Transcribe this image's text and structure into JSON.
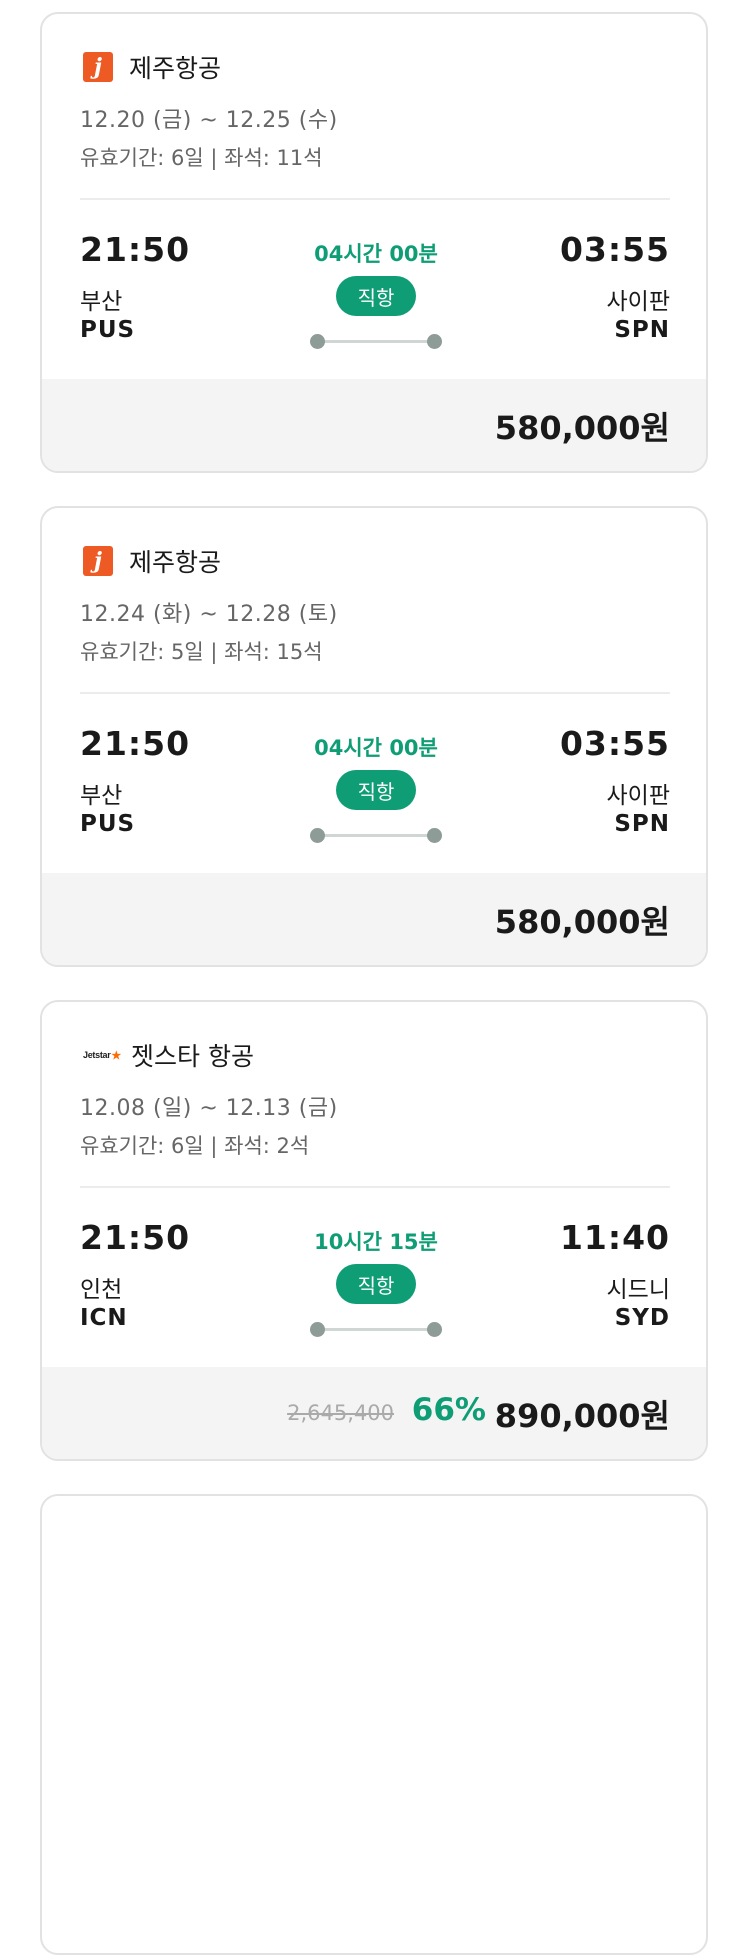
{
  "cards": [
    {
      "airline": "제주항공",
      "logo": "jeju-air-logo",
      "dates": "12.20 (금) ~ 12.25 (수)",
      "validity": "유효기간: 6일 | 좌석: 11석",
      "dep_time": "21:50",
      "dep_city": "부산",
      "dep_code": "PUS",
      "duration": "04시간 00분",
      "flight_type": "직항",
      "arr_time": "03:55",
      "arr_city": "사이판",
      "arr_code": "SPN",
      "price": "580,000원"
    },
    {
      "airline": "제주항공",
      "logo": "jeju-air-logo",
      "dates": "12.24 (화) ~ 12.28 (토)",
      "validity": "유효기간: 5일 | 좌석: 15석",
      "dep_time": "21:50",
      "dep_city": "부산",
      "dep_code": "PUS",
      "duration": "04시간 00분",
      "flight_type": "직항",
      "arr_time": "03:55",
      "arr_city": "사이판",
      "arr_code": "SPN",
      "price": "580,000원"
    },
    {
      "airline": "젯스타 항공",
      "logo": "jetstar-logo",
      "logo_text": "Jetstar",
      "dates": "12.08 (일) ~ 12.13 (금)",
      "validity": "유효기간: 6일 | 좌석: 2석",
      "dep_time": "21:50",
      "dep_city": "인천",
      "dep_code": "ICN",
      "duration": "10시간 15분",
      "flight_type": "직항",
      "arr_time": "11:40",
      "arr_city": "시드니",
      "arr_code": "SYD",
      "original_price": "2,645,400",
      "discount": "66%",
      "price": "890,000원"
    }
  ],
  "colors": {
    "accent": "#0f9d75",
    "jeju_logo": "#ee5a24",
    "footer_bg": "#f4f4f4"
  }
}
